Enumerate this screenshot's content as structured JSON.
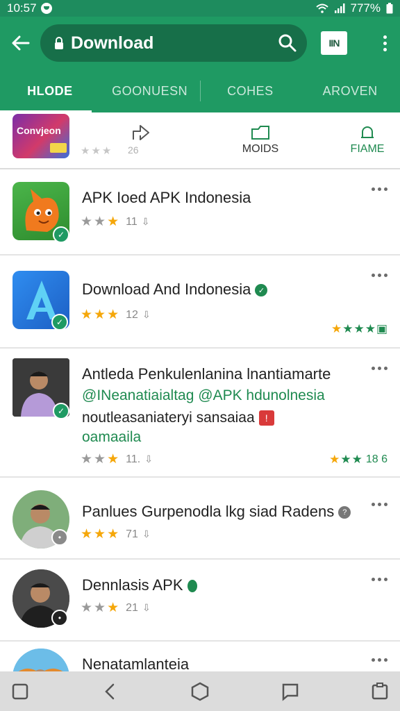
{
  "status": {
    "time": "10:57",
    "battery": "777%"
  },
  "app_bar": {
    "title": "Download",
    "ext_label": "IIN"
  },
  "tabs": [
    {
      "label": "HLODE"
    },
    {
      "label": "GOONUESN"
    },
    {
      "label": "COHES"
    },
    {
      "label": "AROVEN"
    }
  ],
  "featured": {
    "banner_text": "Convjeon",
    "count": "26",
    "action2": "MOIDS",
    "action3": "FIAME"
  },
  "rows": [
    {
      "title": "APK Ioed APK Indonesia",
      "rating_count": "11"
    },
    {
      "title": "Download And Indonesia",
      "rating_count": "12"
    },
    {
      "title": "Antleda Penkulenlanina lnantiamarte",
      "sub1": "@INeanatiaialtag @APK hdunolnesia",
      "sub2": "noutleasaniateryi sansaiaa",
      "sub3": "oamaaila",
      "rating_count": "11.",
      "right_rating": "18 6"
    },
    {
      "title": "Panlues Gurpenodla lkg siad Radens",
      "rating_count": "71"
    },
    {
      "title": "Dennlasis APK",
      "rating_count": "21"
    },
    {
      "title": "Nenatamlanteia"
    }
  ]
}
